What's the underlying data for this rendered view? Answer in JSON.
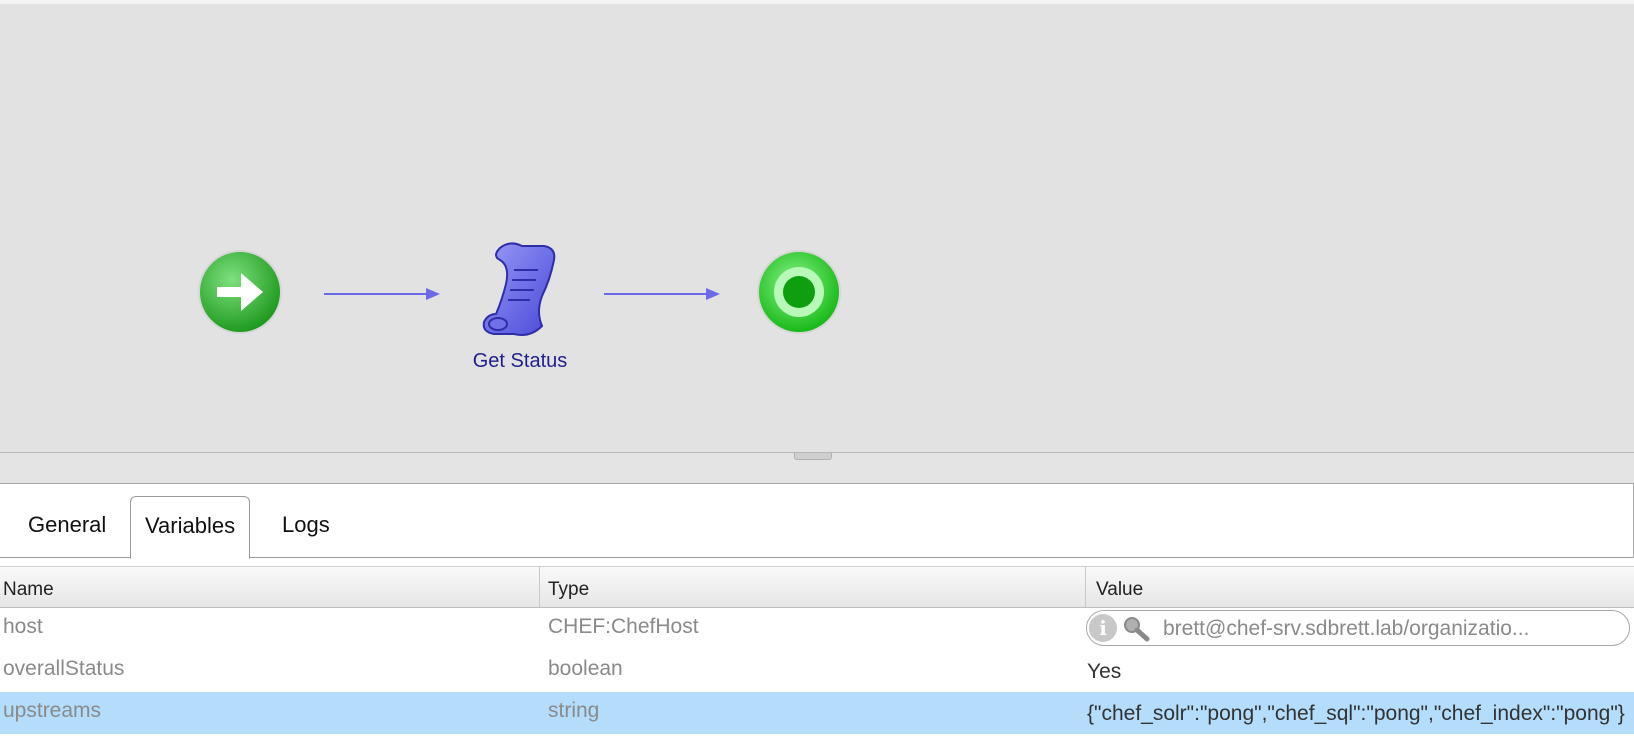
{
  "workflow": {
    "task_label": "Get Status",
    "colors": {
      "arrow": "#6a6ae8",
      "start": "#3cb83c",
      "end": "#22d022",
      "task": "#6f6ff0"
    }
  },
  "tabs": [
    {
      "label": "General",
      "active": false
    },
    {
      "label": "Variables",
      "active": true
    },
    {
      "label": "Logs",
      "active": false
    }
  ],
  "table": {
    "columns": [
      "Name",
      "Type",
      "Value"
    ],
    "rows": [
      {
        "name": "host",
        "type": "CHEF:ChefHost",
        "value": "brett@chef-srv.sdbrett.lab/organizatio..."
      },
      {
        "name": "overallStatus",
        "type": "boolean",
        "value": "Yes"
      },
      {
        "name": "upstreams",
        "type": "string",
        "value": "{\"chef_solr\":\"pong\",\"chef_sql\":\"pong\",\"chef_index\":\"pong\"}",
        "selected": true
      }
    ]
  },
  "selection_color": "#b3ddfb"
}
